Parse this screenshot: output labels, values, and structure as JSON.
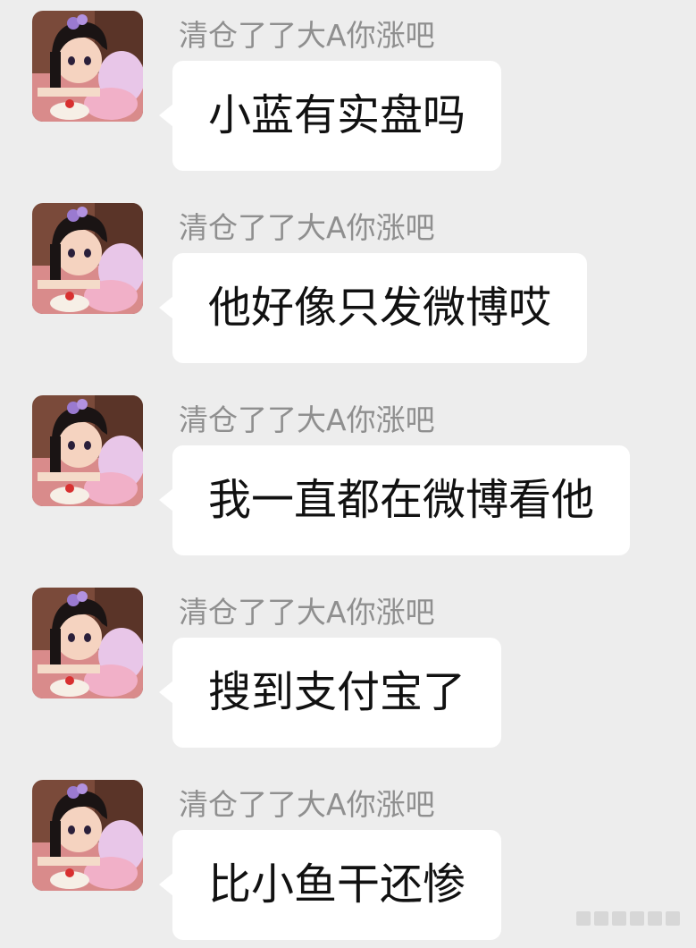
{
  "chat": {
    "messages": [
      {
        "sender": "清仓了了大A你涨吧",
        "text": "小蓝有实盘吗",
        "avatar_icon": "anime-girl-avatar-icon"
      },
      {
        "sender": "清仓了了大A你涨吧",
        "text": "他好像只发微博哎",
        "avatar_icon": "anime-girl-avatar-icon"
      },
      {
        "sender": "清仓了了大A你涨吧",
        "text": "我一直都在微博看他",
        "avatar_icon": "anime-girl-avatar-icon"
      },
      {
        "sender": "清仓了了大A你涨吧",
        "text": "搜到支付宝了",
        "avatar_icon": "anime-girl-avatar-icon"
      },
      {
        "sender": "清仓了了大A你涨吧",
        "text": "比小鱼干还惨",
        "avatar_icon": "anime-girl-avatar-icon"
      }
    ]
  },
  "colors": {
    "background": "#ededed",
    "bubble": "#ffffff",
    "sender_text": "#8f8f8f",
    "message_text": "#111111"
  }
}
